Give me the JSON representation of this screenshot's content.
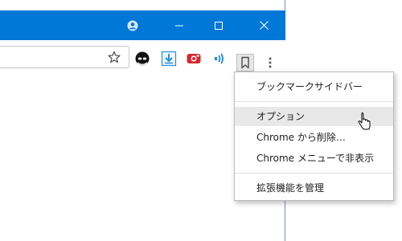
{
  "window": {
    "controls": {
      "profile_icon": "profile-icon",
      "minimize_icon": "minimize-icon",
      "maximize_icon": "maximize-icon",
      "close_icon": "close-icon"
    },
    "accent_color": "#0078d7"
  },
  "toolbar": {
    "star_icon": "star-icon",
    "extensions": [
      {
        "name": "mask-extension-icon",
        "color": "#1a1a1a"
      },
      {
        "name": "download-extension-icon",
        "color": "#2a8fd6"
      },
      {
        "name": "red-camera-extension-icon",
        "color": "#d9262e"
      },
      {
        "name": "speaker-extension-icon",
        "color": "#1e88e5"
      },
      {
        "name": "bookmark-sidebar-extension-icon",
        "color": "#5a5a5a"
      }
    ],
    "menu_icon": "kebab-menu-icon"
  },
  "context_menu": {
    "items": [
      {
        "label": "ブックマークサイドバー"
      },
      {
        "label": "オプション"
      },
      {
        "label": "Chrome から削除…"
      },
      {
        "label": "Chrome メニューで非表示"
      },
      {
        "label": "拡張機能を管理"
      }
    ]
  }
}
